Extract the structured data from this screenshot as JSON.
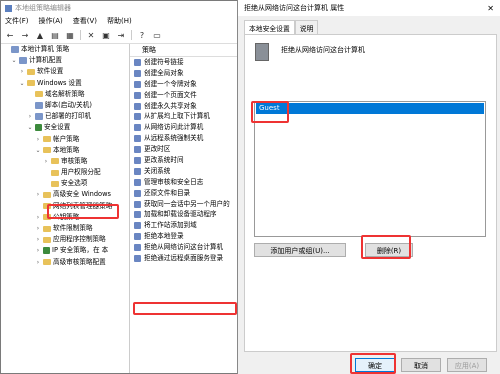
{
  "main": {
    "title": "本地组策略编辑器",
    "menu": [
      "文件(F)",
      "操作(A)",
      "查看(V)",
      "帮助(H)"
    ],
    "tree": [
      {
        "label": "本地计算机 策略",
        "indent": 0,
        "twisty": "",
        "icon": "computer"
      },
      {
        "label": "计算机配置",
        "indent": 1,
        "twisty": "v",
        "icon": "computer"
      },
      {
        "label": "软件设置",
        "indent": 2,
        "twisty": ">",
        "icon": "folder"
      },
      {
        "label": "Windows 设置",
        "indent": 2,
        "twisty": "v",
        "icon": "folder"
      },
      {
        "label": "域名解析策略",
        "indent": 3,
        "twisty": "",
        "icon": "folder"
      },
      {
        "label": "脚本(启动/关机)",
        "indent": 3,
        "twisty": "",
        "icon": "script"
      },
      {
        "label": "已部署的打印机",
        "indent": 3,
        "twisty": ">",
        "icon": "printer"
      },
      {
        "label": "安全设置",
        "indent": 3,
        "twisty": "v",
        "icon": "security"
      },
      {
        "label": "帐户策略",
        "indent": 4,
        "twisty": ">",
        "icon": "folder"
      },
      {
        "label": "本地策略",
        "indent": 4,
        "twisty": "v",
        "icon": "folder"
      },
      {
        "label": "审核策略",
        "indent": 5,
        "twisty": ">",
        "icon": "folder"
      },
      {
        "label": "用户权限分配",
        "indent": 5,
        "twisty": "",
        "icon": "folder"
      },
      {
        "label": "安全选项",
        "indent": 5,
        "twisty": "",
        "icon": "folder"
      },
      {
        "label": "高级安全 Windows",
        "indent": 4,
        "twisty": ">",
        "icon": "folder"
      },
      {
        "label": "网络列表管理器策略",
        "indent": 4,
        "twisty": "",
        "icon": "folder"
      },
      {
        "label": "公钥策略",
        "indent": 4,
        "twisty": ">",
        "icon": "folder"
      },
      {
        "label": "软件限制策略",
        "indent": 4,
        "twisty": ">",
        "icon": "folder"
      },
      {
        "label": "应用程序控制策略",
        "indent": 4,
        "twisty": ">",
        "icon": "folder"
      },
      {
        "label": "IP 安全策略，在 本",
        "indent": 4,
        "twisty": ">",
        "icon": "security"
      },
      {
        "label": "高级审核策略配置",
        "indent": 4,
        "twisty": ">",
        "icon": "folder"
      }
    ],
    "list_header": "策略",
    "policies": [
      "创建符号链接",
      "创建全局对象",
      "创建一个令牌对象",
      "创建一个页面文件",
      "创建永久共享对象",
      "从扩展坞上取下计算机",
      "从网络访问此计算机",
      "从远程系统强制关机",
      "更改时区",
      "更改系统时间",
      "关闭系统",
      "管理审核和安全日志",
      "还原文件和目录",
      "获取同一会话中另一个用户的",
      "加载和卸载设备驱动程序",
      "将工作站添加到域",
      "拒绝本地登录",
      "拒绝从网络访问这台计算机",
      "拒绝通过远程桌面服务登录"
    ]
  },
  "dialog": {
    "title": "拒绝从网络访问这台计算机 属性",
    "tabs": [
      "本地安全设置",
      "说明"
    ],
    "policy_name": "拒绝从网络访问这台计算机",
    "members": [
      "Guest"
    ],
    "add_button": "添加用户或组(U)...",
    "remove_button": "删除(R)",
    "ok_button": "确定",
    "cancel_button": "取消",
    "apply_button": "应用(A)"
  }
}
